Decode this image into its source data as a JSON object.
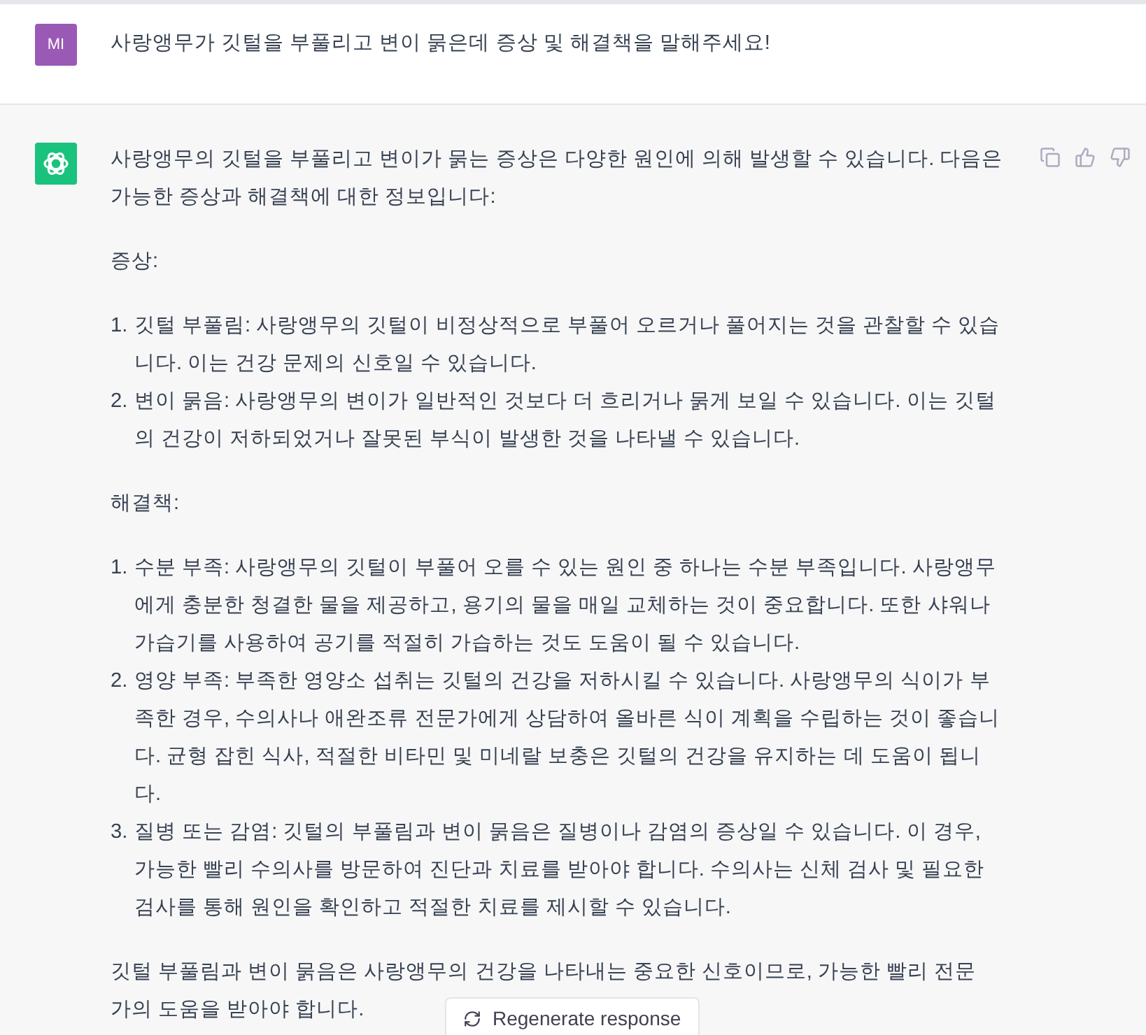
{
  "user_message": {
    "avatar": "MI",
    "text": "사랑앵무가 깃털을 부풀리고 변이 묽은데 증상 및 해결책을 말해주세요!"
  },
  "answer": {
    "blocks": [
      {
        "kind": "paragraph",
        "text": "사랑앵무의 깃털을 부풀리고 변이가 묽는 증상은 다양한 원인에 의해 발생할 수 있습니다. 다음은 가능한 증상과 해결책에 대한 정보입니다:"
      },
      {
        "kind": "paragraph",
        "text": "증상:"
      },
      {
        "kind": "list",
        "items": [
          {
            "number": "1.",
            "text": "깃털 부풀림: 사랑앵무의 깃털이 비정상적으로 부풀어 오르거나 풀어지는 것을 관찰할 수 있습니다. 이는 건강 문제의 신호일 수 있습니다."
          },
          {
            "number": "2.",
            "text": "변이 묽음: 사랑앵무의 변이가 일반적인 것보다 더 흐리거나 묽게 보일 수 있습니다. 이는 깃털의 건강이 저하되었거나 잘못된 부식이 발생한 것을 나타낼 수 있습니다."
          }
        ]
      },
      {
        "kind": "paragraph",
        "text": "해결책:"
      },
      {
        "kind": "list",
        "items": [
          {
            "number": "1.",
            "text": "수분 부족: 사랑앵무의 깃털이 부풀어 오를 수 있는 원인 중 하나는 수분 부족입니다. 사랑앵무에게 충분한 청결한 물을 제공하고, 용기의 물을 매일 교체하는 것이 중요합니다. 또한 샤워나 가습기를 사용하여 공기를 적절히 가습하는 것도 도움이 될 수 있습니다."
          },
          {
            "number": "2.",
            "text": "영양 부족: 부족한 영양소 섭취는 깃털의 건강을 저하시킬 수 있습니다. 사랑앵무의 식이가 부족한 경우, 수의사나 애완조류 전문가에게 상담하여 올바른 식이 계획을 수립하는 것이 좋습니다. 균형 잡힌 식사, 적절한 비타민 및 미네랄 보충은 깃털의 건강을 유지하는 데 도움이 됩니다."
          },
          {
            "number": "3.",
            "text": "질병 또는 감염: 깃털의 부풀림과 변이 묽음은 질병이나 감염의 증상일 수 있습니다. 이 경우, 가능한 빨리 수의사를 방문하여 진단과 치료를 받아야 합니다. 수의사는 신체 검사 및 필요한 검사를 통해 원인을 확인하고 적절한 치료를 제시할 수 있습니다."
          }
        ]
      },
      {
        "kind": "lines",
        "lines": [
          "깃털 부풀림과 변이 묽음은 사랑앵무의 건강을 나타내는 중요한 신호이므로, 가능한 빨리 전문",
          "가의 도움을 받아야 합니다."
        ]
      }
    ]
  },
  "regenerate_button": {
    "label": "Regenerate response"
  }
}
